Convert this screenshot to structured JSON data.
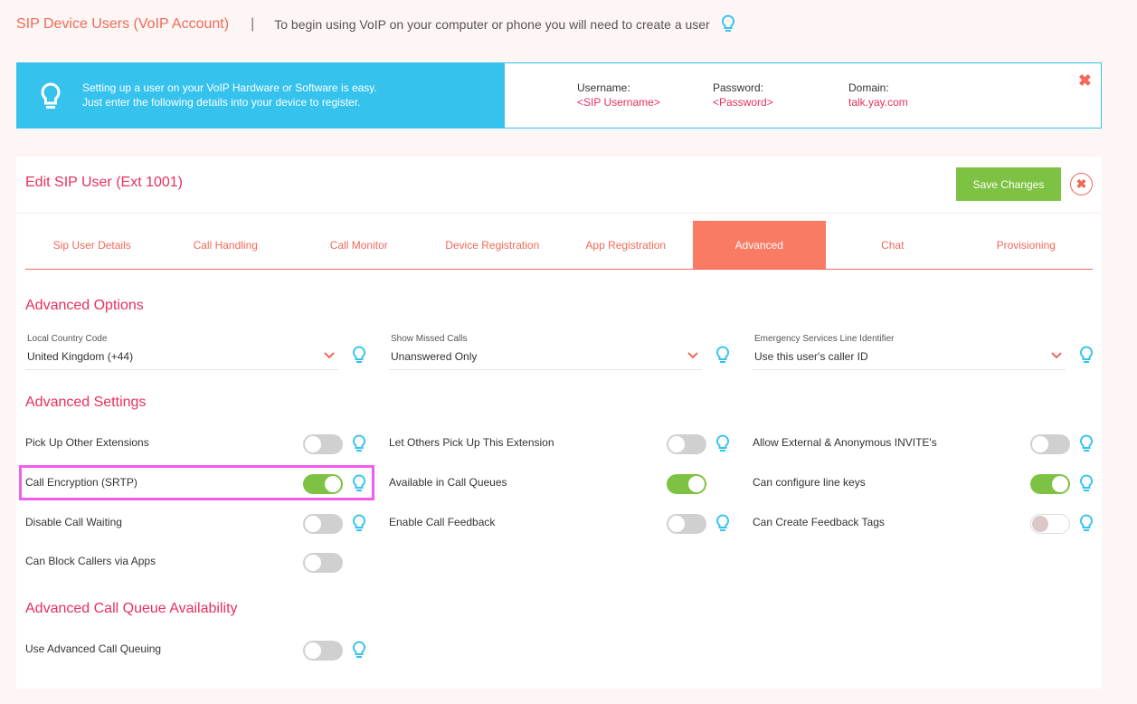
{
  "header": {
    "title": "SIP Device Users (VoIP Account)",
    "separator": "|",
    "description": "To begin using VoIP on your computer or phone you will need to create a user"
  },
  "info": {
    "line1": "Setting up a user on your VoIP Hardware or Software is easy.",
    "line2": "Just enter the following details into your device to register.",
    "username_label": "Username:",
    "username_value": "<SIP Username>",
    "password_label": "Password:",
    "password_value": "<Password>",
    "domain_label": "Domain:",
    "domain_value": "talk.yay.com",
    "close": "✖"
  },
  "card": {
    "title": "Edit SIP User (Ext 1001)",
    "save_label": "Save Changes",
    "close": "✖"
  },
  "tabs": [
    {
      "label": "Sip User Details",
      "active": false
    },
    {
      "label": "Call Handling",
      "active": false
    },
    {
      "label": "Call Monitor",
      "active": false
    },
    {
      "label": "Device Registration",
      "active": false
    },
    {
      "label": "App Registration",
      "active": false
    },
    {
      "label": "Advanced",
      "active": true
    },
    {
      "label": "Chat",
      "active": false
    },
    {
      "label": "Provisioning",
      "active": false
    }
  ],
  "sections": {
    "options": "Advanced Options",
    "settings": "Advanced Settings",
    "queue": "Advanced Call Queue Availability"
  },
  "options": [
    {
      "label": "Local Country Code",
      "value": "United Kingdom (+44)"
    },
    {
      "label": "Show Missed Calls",
      "value": "Unanswered Only"
    },
    {
      "label": "Emergency Services Line Identifier",
      "value": "Use this user's caller ID"
    }
  ],
  "settings": [
    {
      "label": "Pick Up Other Extensions",
      "on": false
    },
    {
      "label": "Let Others Pick Up This Extension",
      "on": false
    },
    {
      "label": "Allow External & Anonymous INVITE's",
      "on": false
    },
    {
      "label": "Call Encryption (SRTP)",
      "on": true
    },
    {
      "label": "Available in Call Queues",
      "on": true
    },
    {
      "label": "Can configure line keys",
      "on": true
    },
    {
      "label": "Disable Call Waiting",
      "on": false
    },
    {
      "label": "Enable Call Feedback",
      "on": false
    },
    {
      "label": "Can Create Feedback Tags",
      "on": false,
      "disabled": true
    },
    {
      "label": "Can Block Callers via Apps",
      "on": false
    }
  ],
  "queue": [
    {
      "label": "Use Advanced Call Queuing",
      "on": false
    }
  ],
  "colors": {
    "accent": "#f06a5a",
    "title": "#e8305e",
    "info_blue": "#35c3ee",
    "toggle_on": "#7dc242",
    "highlight": "#f25cf0"
  }
}
